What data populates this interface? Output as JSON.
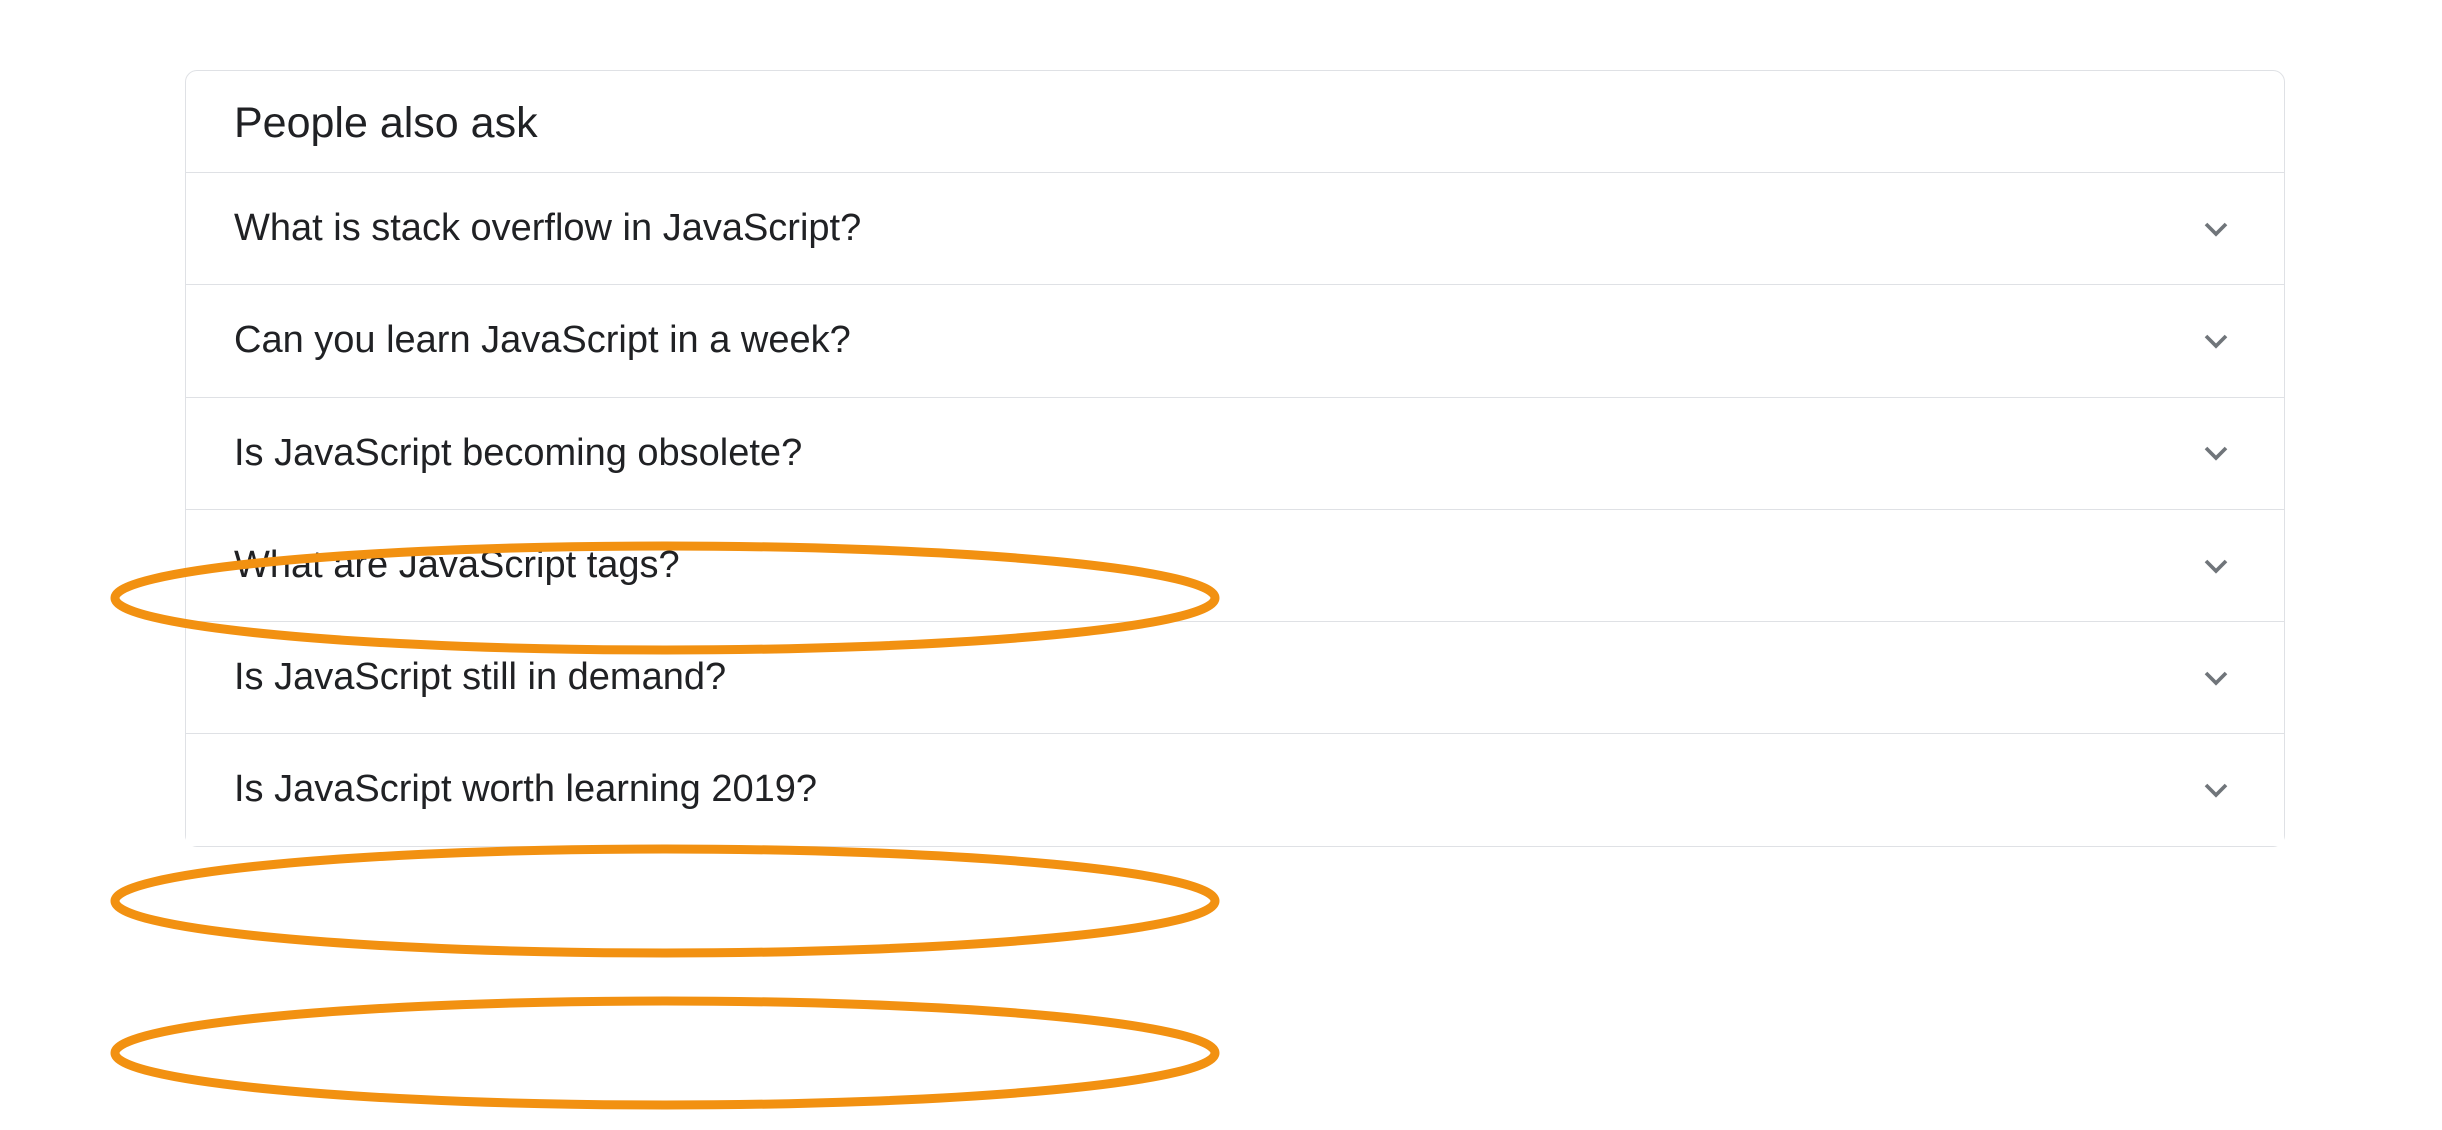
{
  "title": "People also ask",
  "questions": [
    {
      "text": "What is stack overflow in JavaScript?",
      "highlighted": false
    },
    {
      "text": "Can you learn JavaScript in a week?",
      "highlighted": false
    },
    {
      "text": "Is JavaScript becoming obsolete?",
      "highlighted": true
    },
    {
      "text": "What are JavaScript tags?",
      "highlighted": false
    },
    {
      "text": "Is JavaScript still in demand?",
      "highlighted": true
    },
    {
      "text": "Is JavaScript worth learning 2019?",
      "highlighted": true
    }
  ],
  "colors": {
    "annotation": "#F29111",
    "chevron": "#70757a",
    "border": "#dfe1e5",
    "text": "#202124"
  }
}
